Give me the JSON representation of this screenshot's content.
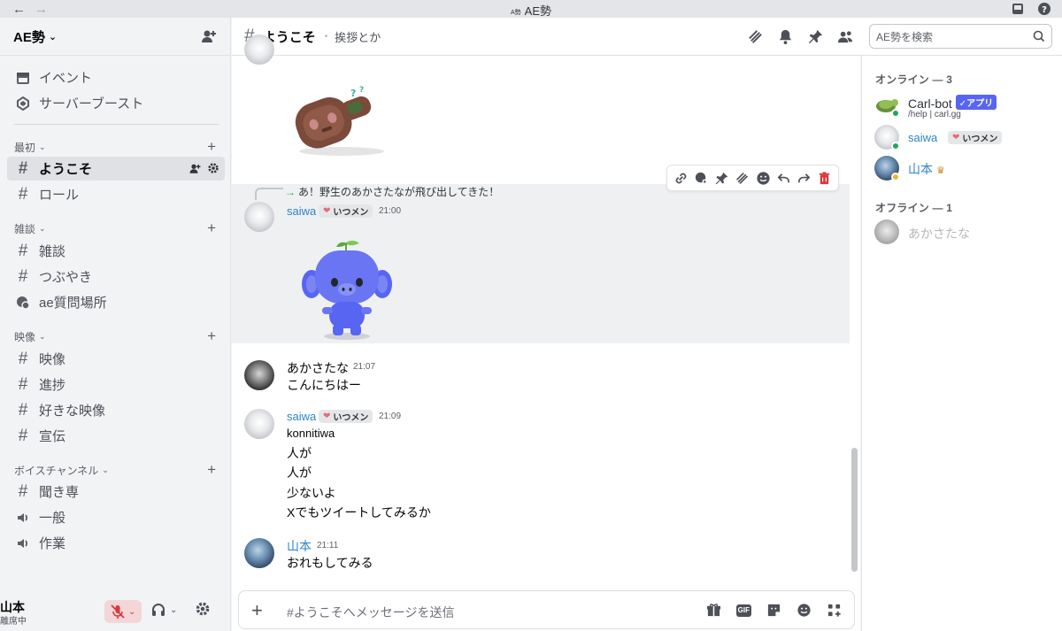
{
  "window": {
    "title": "AE勢",
    "title_mini": "A勢"
  },
  "server": {
    "name": "AE勢"
  },
  "sidebar": {
    "top_items": [
      {
        "label": "イベント",
        "icon": "calendar-icon"
      },
      {
        "label": "サーバーブースト",
        "icon": "boost-icon"
      }
    ],
    "categories": [
      {
        "name": "最初",
        "channels": [
          "ようこそ",
          "ロール"
        ]
      },
      {
        "name": "雑談",
        "channels": [
          "雑談",
          "つぶやき",
          "ae質問場所"
        ]
      },
      {
        "name": "映像",
        "channels": [
          "映像",
          "進捗",
          "好きな映像",
          "宣伝"
        ]
      },
      {
        "name": "ボイスチャンネル",
        "channels": [
          "聞き専",
          "一般",
          "作業"
        ]
      }
    ]
  },
  "user": {
    "name": "山本",
    "status": "離席中"
  },
  "channel": {
    "name": "ようこそ",
    "topic": "挨拶とか"
  },
  "search": {
    "placeholder": "AE勢を検索"
  },
  "messages": {
    "reply_preview": "あ！野生のあかさたなが飛び出してきた！",
    "badge_label": "いつメン",
    "m1": {
      "author": "saiwa",
      "time": "21:00"
    },
    "m2": {
      "author": "あかさたな",
      "time": "21:07",
      "text": "こんにちはー"
    },
    "m3": {
      "author": "saiwa",
      "time": "21:09",
      "lines": [
        "konnitiwa",
        "人が",
        "人が",
        "少ないよ",
        "Xでもツイートしてみるか"
      ]
    },
    "m4": {
      "author": "山本",
      "time": "21:11",
      "text": "おれもしてみる"
    }
  },
  "composer": {
    "placeholder": "#ようこそへメッセージを送信",
    "gif_label": "GIF"
  },
  "members": {
    "online_header": "オンライン — 3",
    "offline_header": "オフライン — 1",
    "online": [
      {
        "name": "Carl-bot",
        "sub": "/help | carl.gg",
        "badge": "✓アプリ"
      },
      {
        "name": "saiwa",
        "badge": "いつメン"
      },
      {
        "name": "山本"
      }
    ],
    "offline": [
      {
        "name": "あかさたな"
      }
    ]
  },
  "colors": {
    "accent": "#5865f2",
    "link_blue": "#2c85c8",
    "online": "#23a55a",
    "idle": "#f0b232",
    "danger": "#da373c"
  }
}
